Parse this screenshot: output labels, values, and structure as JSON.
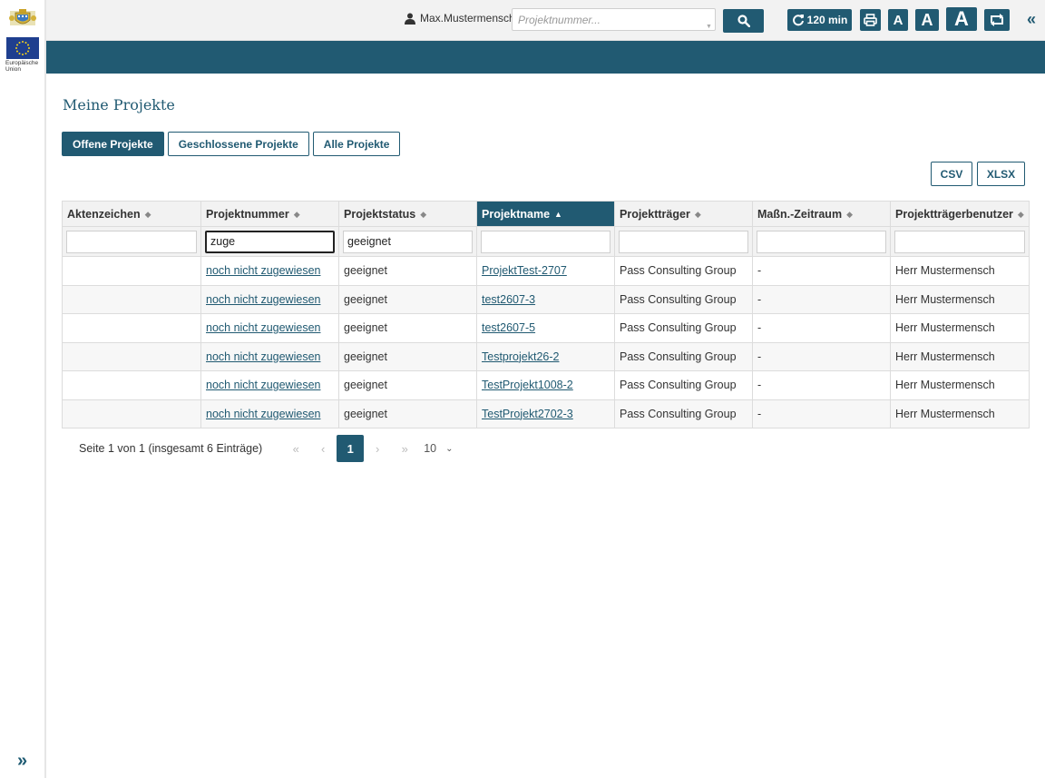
{
  "sidebar": {
    "eu_label": "Europäische Union",
    "expand_icon": "double-chevron-right-icon"
  },
  "header": {
    "user_name": "Max.Mustermensch",
    "search_placeholder": "Projektnummer...",
    "timer_label": "120 min",
    "font_small": "A",
    "font_medium": "A",
    "font_large": "A",
    "collapse_icon": "double-chevron-left-icon"
  },
  "page": {
    "title": "Meine Projekte"
  },
  "tabs": [
    {
      "label": "Offene Projekte",
      "active": true
    },
    {
      "label": "Geschlossene Projekte",
      "active": false
    },
    {
      "label": "Alle Projekte",
      "active": false
    }
  ],
  "export": {
    "csv": "CSV",
    "xlsx": "XLSX"
  },
  "table": {
    "columns": [
      "Aktenzeichen",
      "Projektnummer",
      "Projektstatus",
      "Projektname",
      "Projektträger",
      "Maßn.-Zeitraum",
      "Projektträgerbenutzer"
    ],
    "sorted_column": "Projektname",
    "filters": [
      "",
      "zuge",
      "geeignet",
      "",
      "",
      "",
      ""
    ],
    "rows": [
      [
        "",
        "noch nicht zugewiesen",
        "geeignet",
        "ProjektTest-2707",
        "Pass Consulting Group",
        "-",
        "Herr Mustermensch"
      ],
      [
        "",
        "noch nicht zugewiesen",
        "geeignet",
        "test2607-3",
        "Pass Consulting Group",
        "-",
        "Herr Mustermensch"
      ],
      [
        "",
        "noch nicht zugewiesen",
        "geeignet",
        "test2607-5",
        "Pass Consulting Group",
        "-",
        "Herr Mustermensch"
      ],
      [
        "",
        "noch nicht zugewiesen",
        "geeignet",
        "Testprojekt26-2",
        "Pass Consulting Group",
        "-",
        "Herr Mustermensch"
      ],
      [
        "",
        "noch nicht zugewiesen",
        "geeignet",
        "TestProjekt1008-2",
        "Pass Consulting Group",
        "-",
        "Herr Mustermensch"
      ],
      [
        "",
        "noch nicht zugewiesen",
        "geeignet",
        "TestProjekt2702-3",
        "Pass Consulting Group",
        "-",
        "Herr Mustermensch"
      ]
    ]
  },
  "pagination": {
    "summary": "Seite 1 von 1 (insgesamt 6 Einträge)",
    "current_page": "1",
    "page_size": "10"
  },
  "colors": {
    "primary": "#215a72",
    "header_bg": "#f2f2f2"
  }
}
